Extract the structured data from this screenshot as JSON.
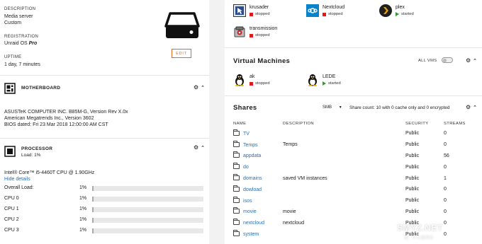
{
  "server": {
    "description_label": "DESCRIPTION",
    "description_line1": "Media server",
    "description_line2": "Custom",
    "registration_label": "REGISTRATION",
    "registration_value": "Unraid OS",
    "registration_tier": "Pro",
    "uptime_label": "UPTIME",
    "uptime_value": "1 day, 7 minutes",
    "edit_label": "EDIT"
  },
  "motherboard": {
    "title": "MOTHERBOARD",
    "line1": "ASUSTeK COMPUTER INC. B85M-G, Version Rev X.0x",
    "line2": "American Megatrends Inc., Version 3602",
    "line3": "BIOS dated: Fri 23 Mar 2018 12:00:00 AM CST"
  },
  "processor": {
    "title": "PROCESSOR",
    "load": "Load: 1%",
    "model": "Intel® Core™ i5-4460T CPU @ 1.90GHz",
    "hide_details": "Hide details",
    "bars": [
      {
        "name": "Overall Load:",
        "pct": "1%",
        "level": 0.01
      },
      {
        "name": "CPU 0",
        "pct": "1%",
        "level": 0.01
      },
      {
        "name": "CPU 1",
        "pct": "1%",
        "level": 0.01
      },
      {
        "name": "CPU 2",
        "pct": "1%",
        "level": 0.01
      },
      {
        "name": "CPU 3",
        "pct": "1%",
        "level": 0.01
      }
    ]
  },
  "docker": {
    "apps": [
      {
        "name": "krusader",
        "status": "stopped"
      },
      {
        "name": "Nextcloud",
        "status": "stopped"
      },
      {
        "name": "plex",
        "status": "started"
      },
      {
        "name": "transmission",
        "status": "stopped"
      }
    ]
  },
  "vms": {
    "title": "Virtual Machines",
    "all_vms": "ALL VMS",
    "items": [
      {
        "name": "ak",
        "status": "stopped"
      },
      {
        "name": "LEDE",
        "status": "started"
      }
    ]
  },
  "shares": {
    "title": "Shares",
    "protocol": "SMB",
    "count_text": "Share count: 10 with 0 cache only and 0 encrypted",
    "columns": [
      "NAME",
      "DESCRIPTION",
      "SECURITY",
      "STREAMS"
    ],
    "rows": [
      {
        "name": "TV",
        "desc": "",
        "security": "Public",
        "streams": "0"
      },
      {
        "name": "Temps",
        "desc": "Temps",
        "security": "Public",
        "streams": "0"
      },
      {
        "name": "appdata",
        "desc": "",
        "security": "Public",
        "streams": "56"
      },
      {
        "name": "do",
        "desc": "",
        "security": "Public",
        "streams": "0"
      },
      {
        "name": "domains",
        "desc": "saved VM instances",
        "security": "Public",
        "streams": "1"
      },
      {
        "name": "dowload",
        "desc": "",
        "security": "Public",
        "streams": "0"
      },
      {
        "name": "isos",
        "desc": "",
        "security": "Public",
        "streams": "0"
      },
      {
        "name": "movie",
        "desc": "movie",
        "security": "Public",
        "streams": "0"
      },
      {
        "name": "nextcloud",
        "desc": "nextcloud",
        "security": "Public",
        "streams": "0"
      },
      {
        "name": "system",
        "desc": "",
        "security": "Public",
        "streams": "0"
      }
    ]
  },
  "watermark": {
    "text": "SMYZ.NET",
    "sub": "值 · 什么值得买"
  },
  "colors": {
    "accent": "#e3691f",
    "link": "#1f6fbf",
    "stopped": "#e01a1a",
    "started": "#2f9c2f"
  }
}
